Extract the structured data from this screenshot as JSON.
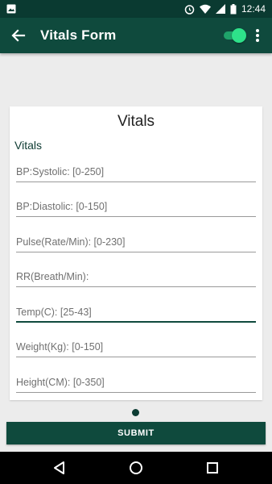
{
  "status_bar": {
    "time": "12:44",
    "icons": [
      "image-icon",
      "alarm-icon",
      "wifi-icon",
      "signal-icon",
      "battery-icon"
    ]
  },
  "app_bar": {
    "title": "Vitals Form",
    "back_icon": "arrow-back-icon",
    "toggle_on": true,
    "more_icon": "more-vert-icon",
    "colors": {
      "bar": "#0f4a3d",
      "status": "#0a3a31",
      "toggle": "#2ee28a"
    }
  },
  "card": {
    "title": "Vitals",
    "section_label": "Vitals",
    "fields": [
      {
        "placeholder": "BP:Systolic: [0-250]",
        "value": ""
      },
      {
        "placeholder": "BP:Diastolic: [0-150]",
        "value": ""
      },
      {
        "placeholder": "Pulse(Rate/Min): [0-230]",
        "value": ""
      },
      {
        "placeholder": "RR(Breath/Min):",
        "value": ""
      },
      {
        "placeholder": "Temp(C): [25-43]",
        "value": "",
        "focused": true
      },
      {
        "placeholder": "Weight(Kg): [0-150]",
        "value": ""
      },
      {
        "placeholder": "Height(CM): [0-350]",
        "value": ""
      }
    ]
  },
  "page_indicator": {
    "current": 1,
    "total": 1
  },
  "submit": {
    "label": "SUBMIT"
  },
  "nav_bar": {
    "icons": [
      "back-triangle-icon",
      "home-circle-icon",
      "recents-square-icon"
    ]
  }
}
